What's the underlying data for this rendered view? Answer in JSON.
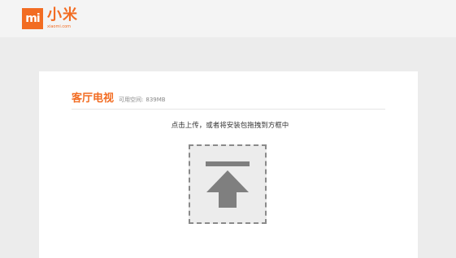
{
  "header": {
    "logo_mark": "mi",
    "logo_name": "小米",
    "logo_url": "xiaomi.com"
  },
  "panel": {
    "device_name": "客厅电视",
    "free_space_label": "可用空间:",
    "free_space_value": "839MB",
    "upload_hint": "点击上传，或者将安装包拖拽到方框中",
    "upload_icon": "upload-arrow-icon"
  },
  "colors": {
    "brand": "#f26c22",
    "dropzone_bg": "#ececec",
    "dropzone_border": "#8a8a8a",
    "icon": "#7f7f7f"
  }
}
